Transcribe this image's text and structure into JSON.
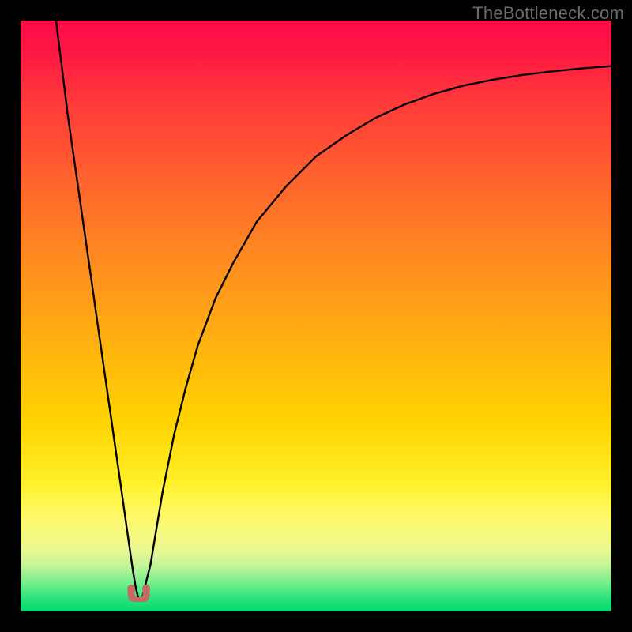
{
  "watermark": "TheBottleneck.com",
  "colors": {
    "frame": "#000000",
    "curve": "#000000",
    "thumb": "#c46a62"
  },
  "chart_data": {
    "type": "line",
    "title": "",
    "xlabel": "",
    "ylabel": "",
    "xlim": [
      0,
      100
    ],
    "ylim": [
      0,
      100
    ],
    "grid": false,
    "series": [
      {
        "name": "bottleneck-curve",
        "x": [
          6,
          7,
          8,
          9,
          10,
          11,
          12,
          13,
          14,
          15,
          16,
          17,
          18,
          19,
          19.5,
          20,
          20.5,
          21,
          22,
          23,
          24,
          26,
          28,
          30,
          33,
          36,
          40,
          45,
          50,
          55,
          60,
          65,
          70,
          75,
          80,
          85,
          90,
          95,
          100
        ],
        "y": [
          100,
          92,
          84,
          77,
          70,
          63,
          56,
          49,
          42,
          35,
          28,
          21,
          14,
          7,
          4,
          2,
          2,
          4,
          8,
          14,
          20,
          30,
          38,
          45,
          53,
          59,
          66,
          72,
          77,
          80.5,
          83.5,
          85.8,
          87.6,
          89,
          90,
          90.8,
          91.4,
          91.9,
          92.3
        ]
      }
    ],
    "annotations": [
      {
        "name": "min-thumb",
        "x": 20,
        "y": 1.6
      }
    ]
  }
}
